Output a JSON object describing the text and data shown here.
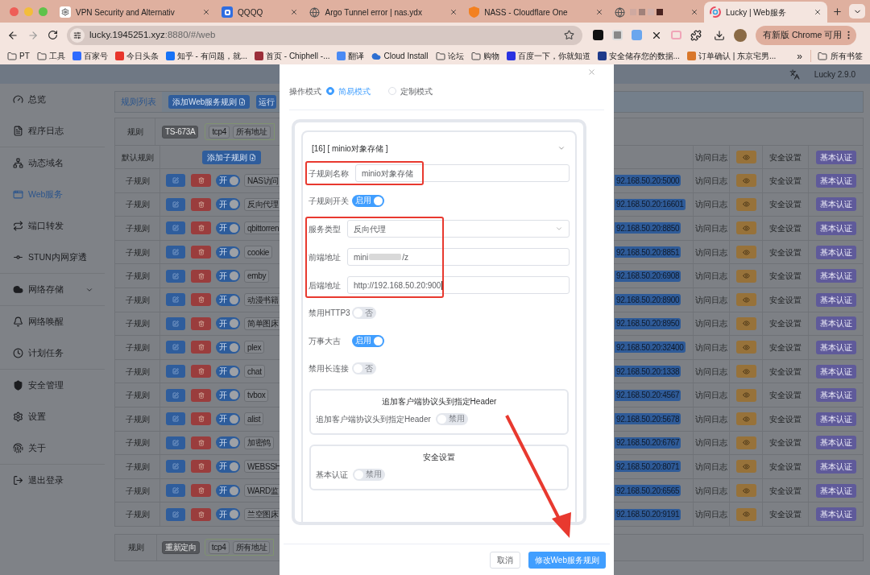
{
  "browser": {
    "tabs": [
      {
        "title": "VPN Security and Alternativ",
        "kind": "ai",
        "selected": false
      },
      {
        "title": "QQQQ",
        "kind": "q",
        "selected": false
      },
      {
        "title": "Argo Tunnel error | nas.ydx",
        "kind": "globe",
        "selected": false
      },
      {
        "title": "NASS - Cloudflare One",
        "kind": "shield",
        "selected": false
      },
      {
        "kind": "blurred",
        "selected": false
      },
      {
        "title": "Lucky | Web服务",
        "kind": "lucky",
        "selected": true
      }
    ],
    "url_host": "lucky.1945251.xyz",
    "url_rest": ":8880/#/web",
    "update_button": "有新版 Chrome 可用",
    "bookmarks": [
      {
        "label": "PT",
        "kind": "folder"
      },
      {
        "label": "工具",
        "kind": "folder"
      },
      {
        "label": "百家号",
        "kind": "site",
        "color": "#2f6bff"
      },
      {
        "label": "今日头条",
        "kind": "site",
        "color": "#e8352b"
      },
      {
        "label": "知乎 - 有问题，就...",
        "kind": "site",
        "color": "#1772f6"
      },
      {
        "label": "首页 - Chiphell -...",
        "kind": "site",
        "color": "#9b2f3a"
      },
      {
        "label": "翻译",
        "kind": "site",
        "color": "#4a8af4"
      },
      {
        "label": "Cloud Install",
        "kind": "cloud",
        "color": "#2d6ed1"
      },
      {
        "label": "论坛",
        "kind": "folder"
      },
      {
        "label": "购物",
        "kind": "folder"
      },
      {
        "label": "百度一下，你就知道",
        "kind": "site",
        "color": "#2932e1"
      },
      {
        "label": "安全储存您的数据...",
        "kind": "site",
        "color": "#1e3a8a"
      },
      {
        "label": "订单确认 | 东京宅男...",
        "kind": "site",
        "color": "#d9772b"
      }
    ],
    "more": "»",
    "all_bookmarks": "所有书签"
  },
  "app": {
    "version": "Lucky 2.9.0",
    "sidebar": [
      {
        "label": "总览",
        "selected": false
      },
      {
        "label": "程序日志",
        "selected": false
      },
      {
        "label": "动态域名",
        "selected": false
      },
      {
        "label": "Web服务",
        "selected": true
      },
      {
        "label": "端口转发",
        "selected": false
      },
      {
        "label": "STUN内网穿透",
        "selected": false
      },
      {
        "label": "网络存储",
        "selected": false,
        "expandable": true
      },
      {
        "label": "网络唤醒",
        "selected": false
      },
      {
        "label": "计划任务",
        "selected": false
      },
      {
        "label": "安全管理",
        "selected": false
      },
      {
        "label": "设置",
        "selected": false
      },
      {
        "label": "关于",
        "selected": false
      },
      {
        "label": "退出登录",
        "selected": false
      }
    ],
    "toolbar": {
      "tab": "规则列表",
      "add_button": "添加Web服务规则",
      "run_button": "运行"
    },
    "rule_row": {
      "label": "规则",
      "name_tag": "TS-673A",
      "tags": [
        "tcp4",
        "所有地址"
      ]
    },
    "default_row": {
      "label": "默认规则",
      "add_button": "添加子规则",
      "log_label": "访问日志",
      "security_label": "安全设置",
      "auth_button": "基本认证"
    },
    "rows": [
      {
        "label": "子规则",
        "on": true,
        "switch_label": "开",
        "name": "NAS访问",
        "target": "92.168.50.20:5000",
        "log_label": "访问日志",
        "security_label": "安全设置",
        "auth_button": "基本认证"
      },
      {
        "label": "子规则",
        "on": true,
        "switch_label": "开",
        "name": "反向代理",
        "target": "92.168.50.20:16601",
        "log_label": "访问日志",
        "security_label": "安全设置",
        "auth_button": "基本认证"
      },
      {
        "label": "子规则",
        "on": true,
        "switch_label": "开",
        "name": "qbittorren",
        "target": "92.168.50.20:8850",
        "log_label": "访问日志",
        "security_label": "安全设置",
        "auth_button": "基本认证"
      },
      {
        "label": "子规则",
        "on": true,
        "switch_label": "开",
        "name": "cookie",
        "target": "92.168.50.20:8851",
        "log_label": "访问日志",
        "security_label": "安全设置",
        "auth_button": "基本认证"
      },
      {
        "label": "子规则",
        "on": true,
        "switch_label": "开",
        "name": "emby",
        "target": "92.168.50.20:6908",
        "log_label": "访问日志",
        "security_label": "安全设置",
        "auth_button": "基本认证"
      },
      {
        "label": "子规则",
        "on": true,
        "switch_label": "开",
        "name": "动漫书籍",
        "target": "92.168.50.20:8900",
        "log_label": "访问日志",
        "security_label": "安全设置",
        "auth_button": "基本认证"
      },
      {
        "label": "子规则",
        "on": true,
        "switch_label": "开",
        "name": "简单图床",
        "target": "92.168.50.20:8950",
        "log_label": "访问日志",
        "security_label": "安全设置",
        "auth_button": "基本认证"
      },
      {
        "label": "子规则",
        "on": true,
        "switch_label": "开",
        "name": "plex",
        "target": "92.168.50.20:32400",
        "log_label": "访问日志",
        "security_label": "安全设置",
        "auth_button": "基本认证"
      },
      {
        "label": "子规则",
        "on": true,
        "switch_label": "开",
        "name": "chat",
        "target": "92.168.50.20:1338",
        "log_label": "访问日志",
        "security_label": "安全设置",
        "auth_button": "基本认证"
      },
      {
        "label": "子规则",
        "on": true,
        "switch_label": "开",
        "name": "tvbox",
        "target": "92.168.50.20:4567",
        "log_label": "访问日志",
        "security_label": "安全设置",
        "auth_button": "基本认证"
      },
      {
        "label": "子规则",
        "on": true,
        "switch_label": "开",
        "name": "alist",
        "target": "92.168.50.20:5678",
        "log_label": "访问日志",
        "security_label": "安全设置",
        "auth_button": "基本认证"
      },
      {
        "label": "子规则",
        "on": true,
        "switch_label": "开",
        "name": "加密鸽",
        "target": "92.168.50.20:6767",
        "log_label": "访问日志",
        "security_label": "安全设置",
        "auth_button": "基本认证"
      },
      {
        "label": "子规则",
        "on": true,
        "switch_label": "开",
        "name": "WEBSSH",
        "target": "92.168.50.20:8071",
        "log_label": "访问日志",
        "security_label": "安全设置",
        "auth_button": "基本认证"
      },
      {
        "label": "子规则",
        "on": true,
        "switch_label": "开",
        "name": "WARD监",
        "target": "92.168.50.20:6565",
        "log_label": "访问日志",
        "security_label": "安全设置",
        "auth_button": "基本认证"
      },
      {
        "label": "子规则",
        "on": true,
        "switch_label": "开",
        "name": "兰空图床",
        "target": "92.168.50.20:9191",
        "log_label": "访问日志",
        "security_label": "安全设置",
        "auth_button": "基本认证"
      }
    ],
    "bottom_rule": {
      "label": "规则",
      "name_tag": "重新定向",
      "tags": [
        "tcp4",
        "所有地址"
      ]
    }
  },
  "modal": {
    "mode": {
      "label": "操作模式",
      "options": [
        {
          "label": "简易模式",
          "selected": true
        },
        {
          "label": "定制模式",
          "selected": false
        }
      ]
    },
    "rule_title": "[16] [ minio对象存储 ]",
    "groups": [
      {
        "highlighted": true,
        "fields": [
          {
            "kind": "text",
            "label": "子规则名称",
            "value": "minio对象存储"
          }
        ]
      },
      {
        "highlighted": false,
        "fields": [
          {
            "kind": "switch",
            "label": "子规则开关",
            "on": true,
            "switch_label": "启用"
          }
        ]
      },
      {
        "highlighted": true,
        "fields": [
          {
            "kind": "select",
            "label": "服务类型",
            "value": "反向代理"
          },
          {
            "kind": "textarea",
            "label": "前端地址",
            "value": "mini",
            "value_end": "/z",
            "blurred": true
          },
          {
            "kind": "textarea",
            "label": "后端地址",
            "value": "http://192.168.50.20:900",
            "cursor": true
          }
        ]
      },
      {
        "highlighted": false,
        "fields": [
          {
            "kind": "switch",
            "label": "禁用HTTP3",
            "on": false,
            "switch_label": "否"
          },
          {
            "kind": "switch",
            "label": "万事大吉",
            "on": true,
            "switch_label": "启用"
          },
          {
            "kind": "switch",
            "label": "禁用长连接",
            "on": false,
            "switch_label": "否"
          }
        ]
      }
    ],
    "sections": [
      {
        "title": "追加客户端协议头到指定Header",
        "fields": [
          {
            "kind": "switch",
            "label": "追加客户端协议头到指定Header",
            "on": false,
            "switch_label": "禁用"
          }
        ]
      },
      {
        "title": "安全设置",
        "fields": [
          {
            "kind": "switch",
            "label": "基本认证",
            "on": false,
            "switch_label": "禁用"
          }
        ]
      }
    ],
    "buttons": [
      {
        "label": "取消",
        "kind": "secondary"
      },
      {
        "label": "修改Web服务规则",
        "kind": "primary"
      }
    ]
  }
}
